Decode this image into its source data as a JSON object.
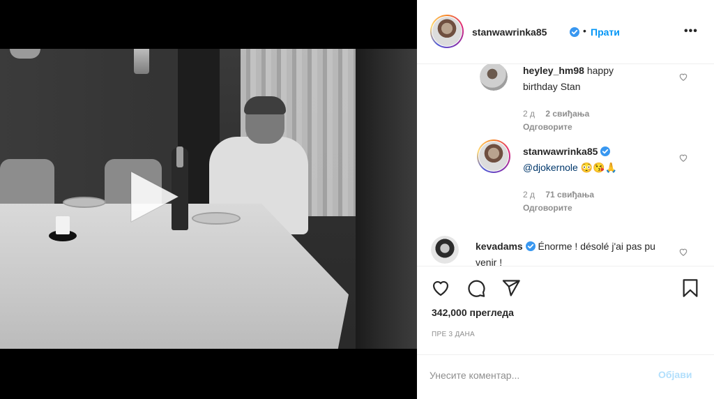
{
  "post": {
    "author": "stanwawrinka85",
    "follow_label": "Прати",
    "separator": "•",
    "more_label": "•••"
  },
  "comments": [
    {
      "username": "heyley_hm98",
      "text": "happy birthday Stan",
      "age": "2 д",
      "likes": "2 свиђања",
      "reply_label": "Одговорите",
      "verified": false
    },
    {
      "username": "stanwawrinka85",
      "text_mention": "@djokernole",
      "text_emoji": "😳😘🙏",
      "age": "2 д",
      "likes": "71 свиђања",
      "reply_label": "Одговорите",
      "verified": true
    },
    {
      "username": "kevadams",
      "text": "Énorme ! désolé j'ai pas pu venir !",
      "verified": true
    }
  ],
  "actions": {
    "views": "342,000 прегледа",
    "time": "ПРЕ 3 ДАНА"
  },
  "composer": {
    "placeholder": "Унесите коментар...",
    "post_label": "Објави"
  },
  "colors": {
    "accent": "#0095f6",
    "verified": "#3897f0",
    "muted": "#8e8e8e"
  }
}
